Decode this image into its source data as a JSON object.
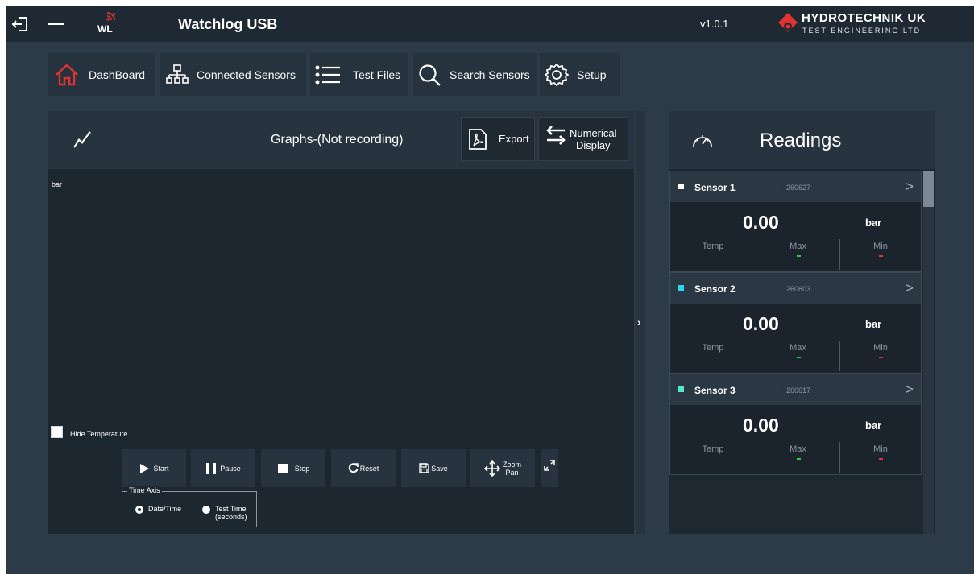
{
  "app": {
    "title": "Watchlog USB",
    "version": "v1.0.1",
    "logo_text": "WL",
    "brand_name": "HYDROTECHNIK UK",
    "brand_subtitle": "TEST ENGINEERING LTD"
  },
  "nav": [
    {
      "label": "DashBoard",
      "icon": "home-icon"
    },
    {
      "label": "Connected Sensors",
      "icon": "network-icon"
    },
    {
      "label": "Test Files",
      "icon": "list-icon"
    },
    {
      "label": "Search Sensors",
      "icon": "search-icon"
    },
    {
      "label": "Setup",
      "icon": "gear-icon"
    }
  ],
  "graph": {
    "title": "Graphs-(Not recording)",
    "export_label": "Export",
    "numerical_label_1": "Numerical",
    "numerical_label_2": "Display",
    "y_unit": "bar",
    "hide_temperature": "Hide Temperature",
    "hide_temperature_checked": false,
    "controls": {
      "start": "Start",
      "pause": "Pause",
      "stop": "Stop",
      "reset": "Reset",
      "save": "Save",
      "zoom": "Zoom",
      "pan": "Pan"
    },
    "time_axis": {
      "legend": "Time Axis",
      "option_1": "Date/Time",
      "option_2_line1": "Test Time",
      "option_2_line2": "(seconds)",
      "selected": "Date/Time"
    }
  },
  "readings": {
    "title": "Readings",
    "sensors": [
      {
        "name": "Sensor 1",
        "serial": "260627",
        "value": "0.00",
        "unit": "bar",
        "temp_label": "Temp",
        "max_label": "Max",
        "min_label": "Min",
        "color": "#ffffff"
      },
      {
        "name": "Sensor 2",
        "serial": "260603",
        "value": "0.00",
        "unit": "bar",
        "temp_label": "Temp",
        "max_label": "Max",
        "min_label": "Min",
        "color": "#26d9ef"
      },
      {
        "name": "Sensor 3",
        "serial": "260617",
        "value": "0.00",
        "unit": "bar",
        "temp_label": "Temp",
        "max_label": "Max",
        "min_label": "Min",
        "color": "#59e6c8"
      }
    ]
  },
  "colors": {
    "accent_red": "#e0332f",
    "max_green": "#2ecc40",
    "min_red": "#e0334a"
  }
}
